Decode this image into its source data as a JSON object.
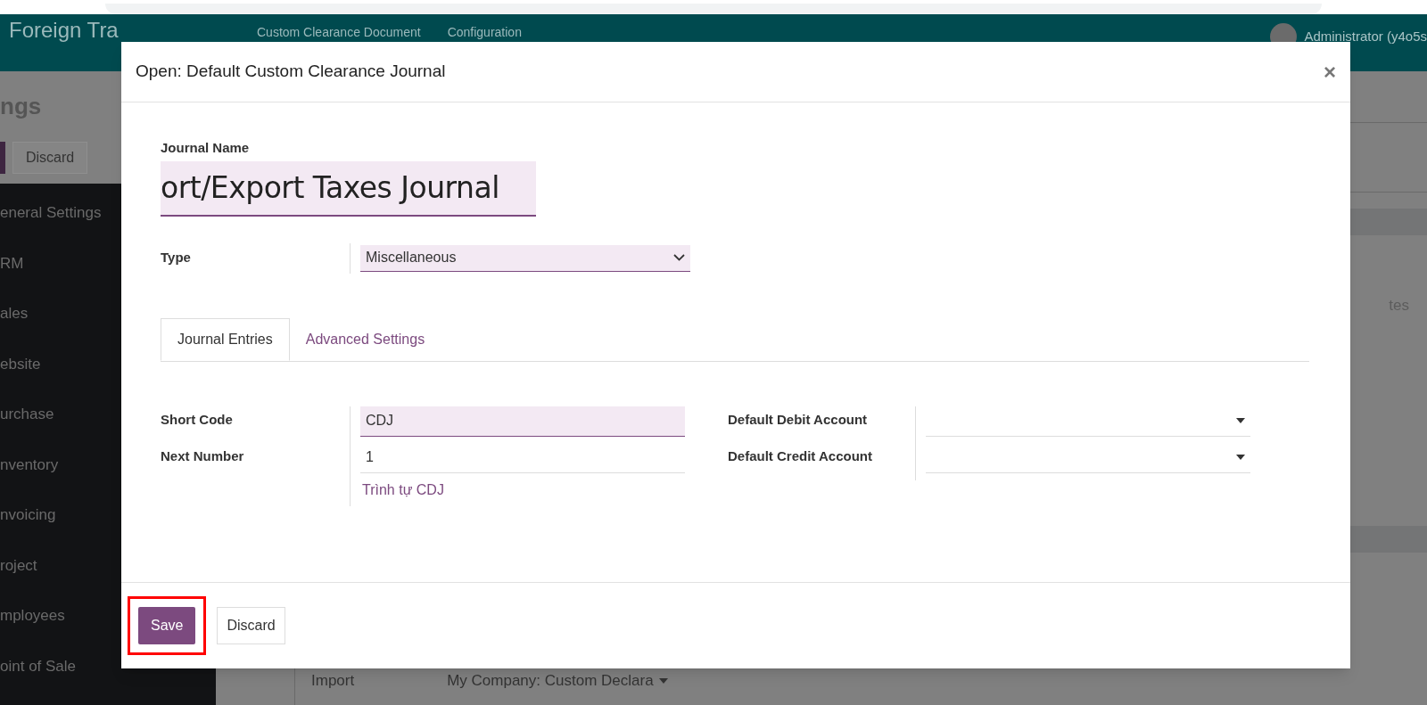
{
  "app": {
    "title": "Foreign Tra",
    "menu": [
      "Custom Clearance Document",
      "Configuration"
    ],
    "user": "Administrator (y4o5s"
  },
  "page": {
    "title": "ngs",
    "discard": "Discard",
    "side_text": "tes",
    "import_label": "Import",
    "import_value": "My Company: Custom Declara"
  },
  "sidebar": {
    "items": [
      {
        "label": "eneral Settings"
      },
      {
        "label": "RM"
      },
      {
        "label": "ales"
      },
      {
        "label": "ebsite"
      },
      {
        "label": "urchase"
      },
      {
        "label": "nventory"
      },
      {
        "label": "nvoicing"
      },
      {
        "label": "roject"
      },
      {
        "label": "mployees"
      },
      {
        "label": "oint of Sale"
      }
    ]
  },
  "dialog": {
    "title": "Open: Default Custom Clearance Journal",
    "close": "×",
    "name_label": "Journal Name",
    "name_value": "ort/Export Taxes Journal",
    "type_label": "Type",
    "type_value": "Miscellaneous",
    "tabs": [
      {
        "label": "Journal Entries",
        "selected": true
      },
      {
        "label": "Advanced Settings",
        "selected": false
      }
    ],
    "left_fields": [
      {
        "kind": "input",
        "label": "Short Code",
        "value": "CDJ",
        "focused": true
      },
      {
        "kind": "input",
        "label": "Next Number",
        "value": "1",
        "focused": false
      }
    ],
    "sequence_link": "Trình tự CDJ",
    "right_fields": [
      {
        "kind": "select",
        "label": "Default Debit Account"
      },
      {
        "kind": "select",
        "label": "Default Credit Account"
      }
    ],
    "buttons": [
      {
        "label": "Save",
        "kind": "primary",
        "highlighted": true
      },
      {
        "label": "Discard",
        "kind": "secondary",
        "highlighted": false
      }
    ]
  }
}
